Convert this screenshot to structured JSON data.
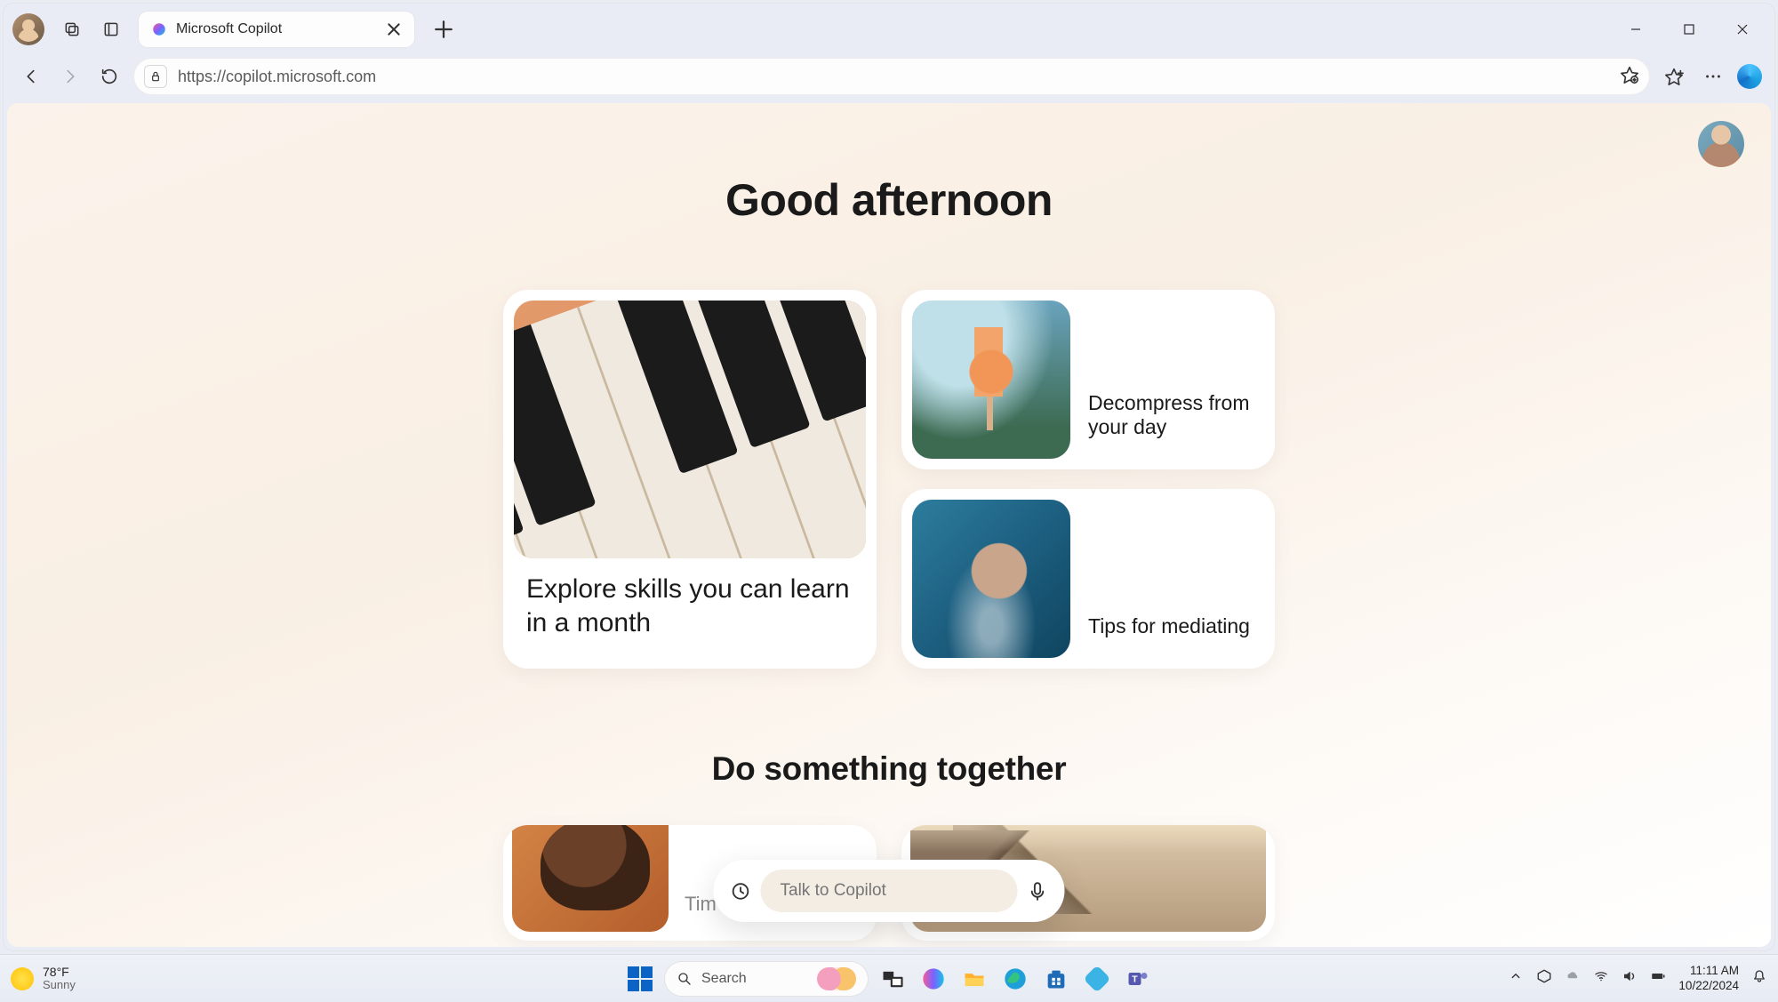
{
  "browser": {
    "tab_title": "Microsoft Copilot",
    "url": "https://copilot.microsoft.com"
  },
  "page": {
    "greeting": "Good afternoon",
    "card_large": "Explore skills you can learn in a month",
    "card_small_1": "Decompress from your day",
    "card_small_2": "Tips for mediating",
    "section2": "Do something together",
    "card_bottom_1": "Tim",
    "talk_placeholder": "Talk to Copilot"
  },
  "taskbar": {
    "temp": "78°F",
    "condition": "Sunny",
    "search_placeholder": "Search",
    "time": "11:11 AM",
    "date": "10/22/2024"
  }
}
